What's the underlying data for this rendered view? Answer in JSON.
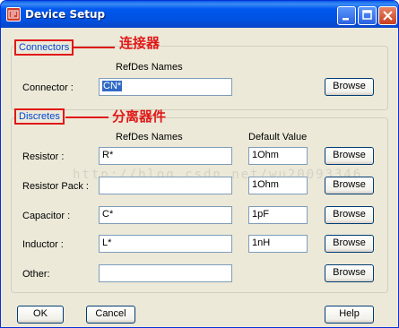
{
  "window": {
    "title": "Device Setup"
  },
  "connectors": {
    "group_label": "Connectors",
    "annotation": "连接器",
    "refdes_header": "RefDes Names",
    "rows": [
      {
        "label": "Connector :",
        "value": "CN*",
        "browse": "Browse"
      }
    ]
  },
  "discretes": {
    "group_label": "Discretes",
    "annotation": "分离器件",
    "refdes_header": "RefDes Names",
    "default_header": "Default Value",
    "rows": [
      {
        "label": "Resistor :",
        "value": "R*",
        "default": "1Ohm",
        "browse": "Browse"
      },
      {
        "label": "Resistor Pack :",
        "value": "",
        "default": "1Ohm",
        "browse": "Browse"
      },
      {
        "label": "Capacitor :",
        "value": "C*",
        "default": "1pF",
        "browse": "Browse"
      },
      {
        "label": "Inductor :",
        "value": "L*",
        "default": "1nH",
        "browse": "Browse"
      },
      {
        "label": "Other:",
        "value": "",
        "browse": "Browse"
      }
    ]
  },
  "watermark": "http://blog.csdn.net/wu20093346",
  "footer": {
    "ok": "OK",
    "cancel": "Cancel",
    "help": "Help"
  }
}
